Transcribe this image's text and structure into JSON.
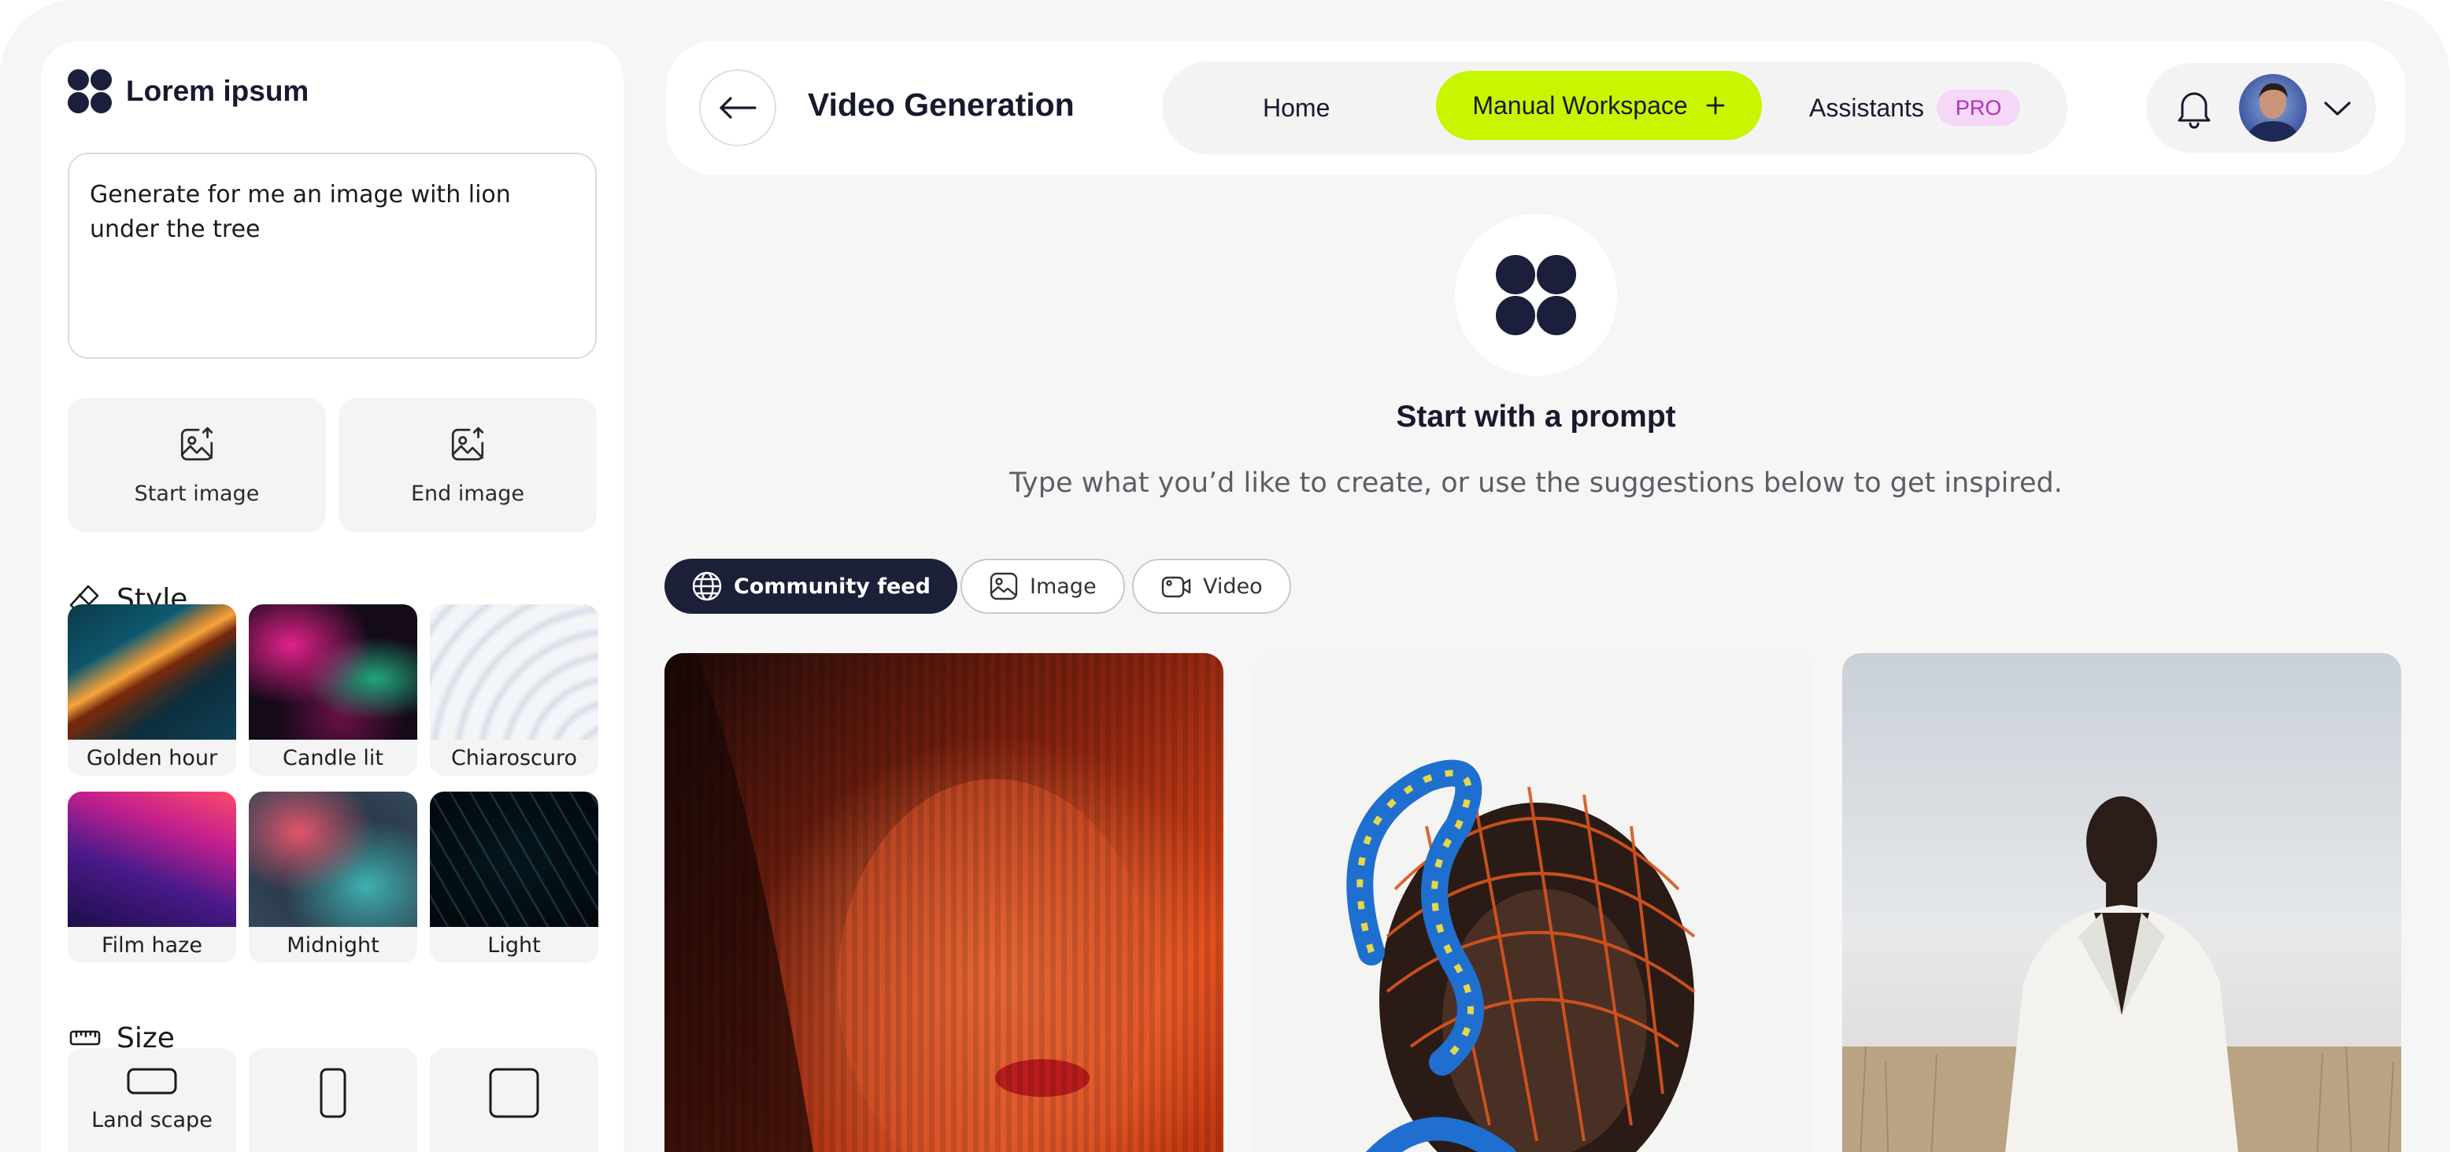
{
  "sidebar": {
    "brand": "Lorem ipsum",
    "prompt": "Generate for me an image with lion under the tree",
    "start_image": "Start image",
    "end_image": "End image",
    "style_heading": "Style",
    "styles": [
      {
        "label": "Golden hour"
      },
      {
        "label": "Candle lit"
      },
      {
        "label": "Chiaroscuro"
      },
      {
        "label": "Film haze"
      },
      {
        "label": "Midnight"
      },
      {
        "label": "Light"
      }
    ],
    "size_heading": "Size",
    "sizes": [
      {
        "label": "Land scape",
        "icon": "landscape-icon"
      },
      {
        "label": "",
        "icon": "portrait-icon"
      },
      {
        "label": "",
        "icon": "square-icon"
      }
    ]
  },
  "header": {
    "title": "Video Generation",
    "nav": {
      "home": "Home",
      "manual": "Manual Workspace",
      "assistants": "Assistants",
      "pro_badge": "PRO"
    }
  },
  "main": {
    "title": "Start with a prompt",
    "subtitle": "Type what you’d like to create, or use the suggestions below to get inspired.",
    "filters": {
      "community": "Community feed",
      "image": "Image",
      "video": "Video"
    }
  },
  "colors": {
    "accent": "#c8f500",
    "dark": "#1b2038",
    "pro_bg": "#f5d7f7",
    "pro_text": "#b52bc4"
  }
}
